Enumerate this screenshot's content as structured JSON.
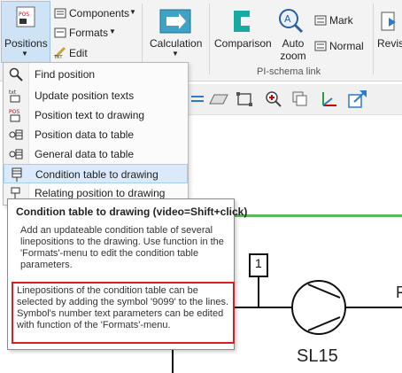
{
  "ribbon": {
    "positions_label": "Positions",
    "components_label": "Components",
    "formats_label": "Formats",
    "edit_label": "Edit",
    "calculation_label": "Calculation",
    "comparison_label": "Comparison",
    "auto_zoom_label": "Auto zoom",
    "mark_label": "Mark",
    "normal_label": "Normal",
    "revision_label": "Revisi",
    "group_pi_schema_link": "PI-schema link",
    "pos_icon_text": "POS"
  },
  "menu": {
    "items": [
      {
        "label": "Find position",
        "icon": "search-icon"
      },
      {
        "label": "Update position texts",
        "icon": "update-text-icon"
      },
      {
        "label": "Position text to drawing",
        "icon": "pos-text-icon"
      },
      {
        "label": "Position data to table",
        "icon": "pos-table-icon"
      },
      {
        "label": "General data to table",
        "icon": "general-table-icon"
      },
      {
        "label": "Condition table to drawing",
        "icon": "condition-table-icon"
      },
      {
        "label": "Relating position to drawing",
        "icon": "relating-pos-icon"
      }
    ]
  },
  "tooltip": {
    "title": "Condition table to drawing (video=Shift+click)",
    "description": "Add an updateable condition table of several linepositions to the drawing. Use function in the 'Formats'-menu to edit the condition table parameters.",
    "note": "Linepositions of the condition table can be selected by adding the symbol '9099' to the lines. Symbol's number text parameters can be edited with function of the 'Formats'-menu."
  },
  "schema": {
    "pump_label": "SL15",
    "tag_number": "1",
    "edge_letter": "F"
  },
  "colors": {
    "highlight": "#cfe3f7",
    "note_border": "#d81e1e",
    "green_line": "#5cb85c"
  }
}
